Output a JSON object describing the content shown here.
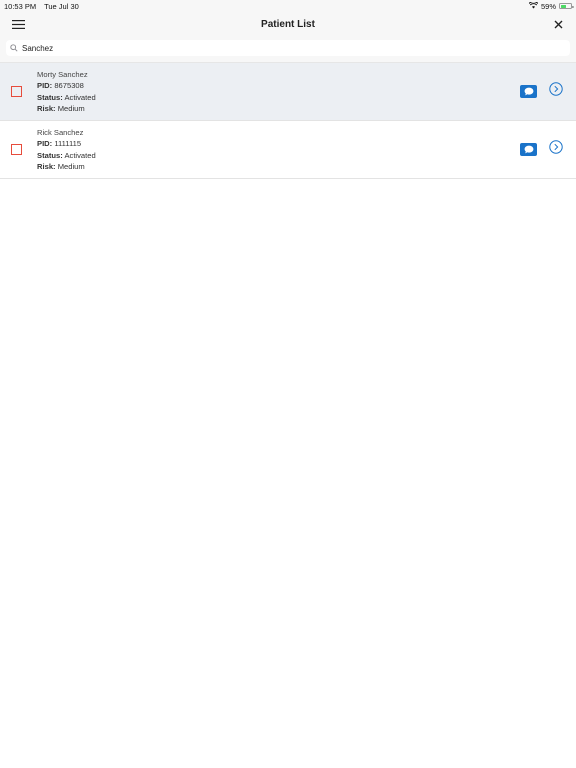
{
  "status_bar": {
    "time": "10:53 PM",
    "date": "Tue Jul 30",
    "battery_percent": "59%",
    "battery_level": 0.59
  },
  "nav": {
    "title": "Patient List",
    "menu_icon": "hamburger-menu-icon",
    "close_icon": "close-icon"
  },
  "search": {
    "value": "Sanchez",
    "icon": "search-icon"
  },
  "labels": {
    "pid": "PID:",
    "status": "Status:",
    "risk": "Risk:"
  },
  "patients": [
    {
      "name": "Morty Sanchez",
      "pid": "8675308",
      "status": "Activated",
      "risk": "Medium",
      "highlighted": true
    },
    {
      "name": "Rick Sanchez",
      "pid": "1111115",
      "status": "Activated",
      "risk": "Medium",
      "highlighted": false
    }
  ],
  "colors": {
    "accent": "#1a73c9",
    "checkbox_border": "#e74c3c",
    "highlight_row": "#eceff3"
  }
}
